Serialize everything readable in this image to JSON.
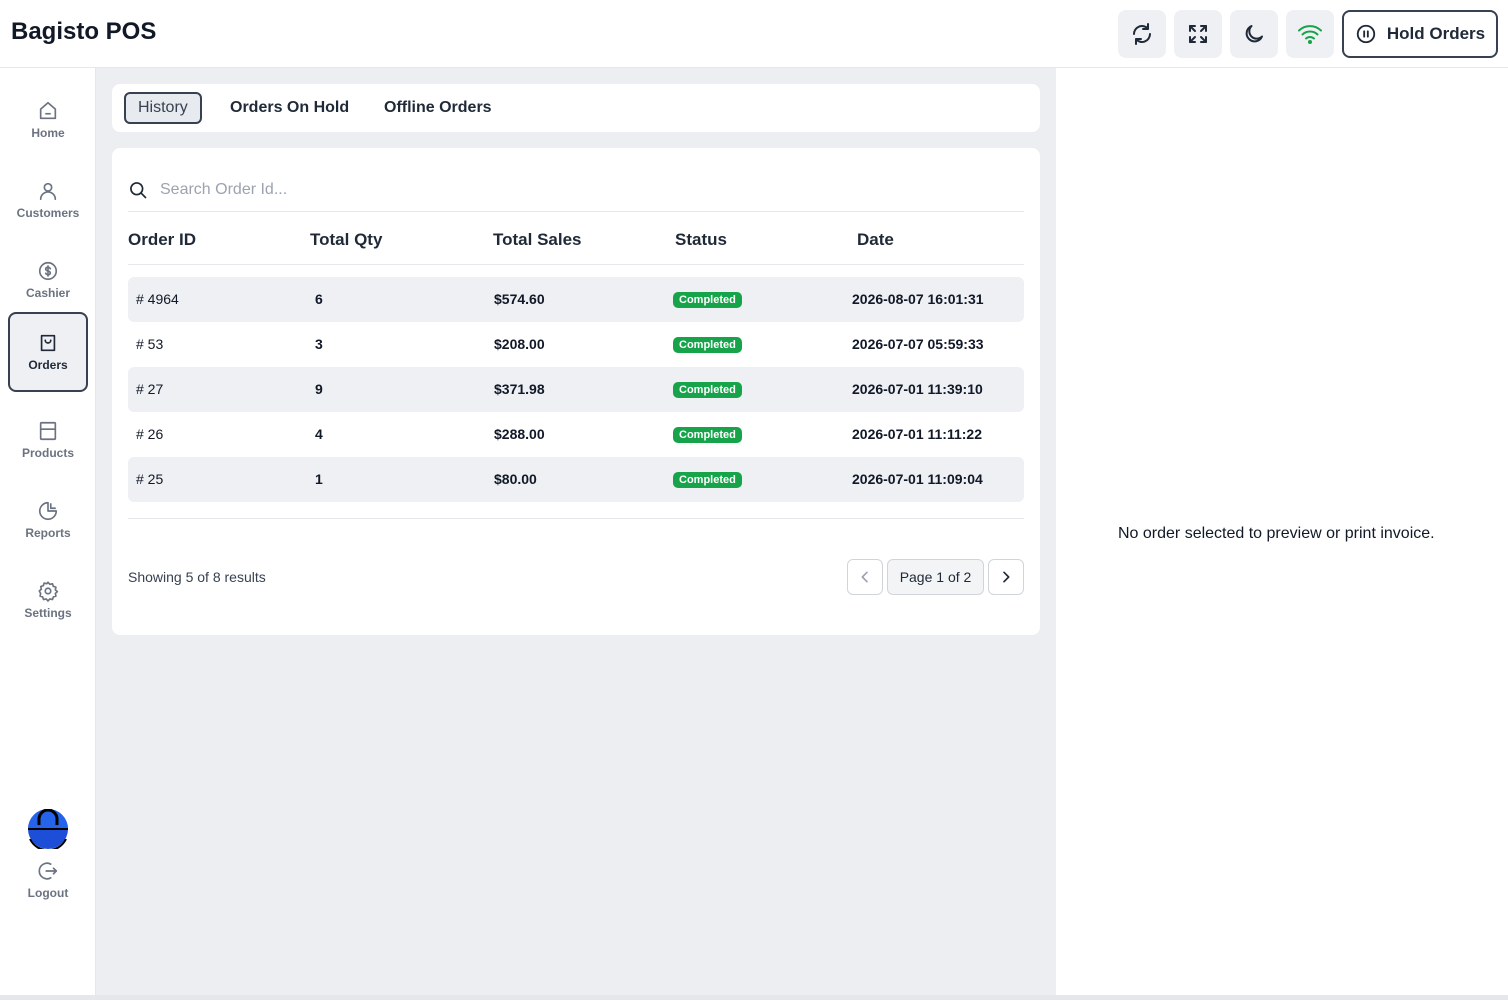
{
  "app": {
    "title": "Bagisto POS"
  },
  "header": {
    "hold_orders_label": "Hold Orders",
    "colors": {
      "wifi": "#16a34a"
    }
  },
  "sidebar": {
    "items": [
      {
        "label": "Home",
        "icon": "home-icon"
      },
      {
        "label": "Customers",
        "icon": "user-icon"
      },
      {
        "label": "Cashier",
        "icon": "dollar-icon"
      },
      {
        "label": "Orders",
        "icon": "bag-icon",
        "active": true
      },
      {
        "label": "Products",
        "icon": "box-icon"
      },
      {
        "label": "Reports",
        "icon": "pie-chart-icon"
      },
      {
        "label": "Settings",
        "icon": "gear-icon"
      }
    ],
    "logout_label": "Logout"
  },
  "tabs": [
    {
      "label": "History",
      "active": true
    },
    {
      "label": "Orders On Hold"
    },
    {
      "label": "Offline Orders"
    }
  ],
  "search": {
    "placeholder": "Search Order Id..."
  },
  "table": {
    "columns": [
      "Order ID",
      "Total Qty",
      "Total Sales",
      "Status",
      "Date"
    ],
    "rows": [
      {
        "order_id": "# 4964",
        "qty": "6",
        "sales": "$574.60",
        "status": "Completed",
        "date": "2026-08-07 16:01:31"
      },
      {
        "order_id": "# 53",
        "qty": "3",
        "sales": "$208.00",
        "status": "Completed",
        "date": "2026-07-07 05:59:33"
      },
      {
        "order_id": "# 27",
        "qty": "9",
        "sales": "$371.98",
        "status": "Completed",
        "date": "2026-07-01 11:39:10"
      },
      {
        "order_id": "# 26",
        "qty": "4",
        "sales": "$288.00",
        "status": "Completed",
        "date": "2026-07-01 11:11:22"
      },
      {
        "order_id": "# 25",
        "qty": "1",
        "sales": "$80.00",
        "status": "Completed",
        "date": "2026-07-01 11:09:04"
      }
    ]
  },
  "pagination": {
    "showing": "Showing 5 of 8 results",
    "page_label": "Page 1 of 2"
  },
  "preview": {
    "empty_message": "No order selected to preview or print invoice."
  },
  "colors": {
    "status_completed": "#16a34a",
    "avatar": "#1d4ed8"
  }
}
